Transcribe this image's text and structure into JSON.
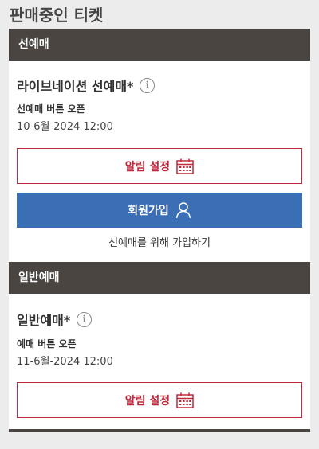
{
  "page": {
    "title": "판매중인 티켓"
  },
  "presale": {
    "header": "선예매",
    "ticket_name": "라이브네이션 선예매*",
    "open_label": "선예매 버튼 오픈",
    "open_date": "10-6월-2024 12:00",
    "alarm_label": "알림 설정",
    "join_label": "회원가입",
    "join_note": "선예매를 위해 가입하기"
  },
  "general": {
    "header": "일반예매",
    "ticket_name": "일반예매*",
    "open_label": "예매 버튼 오픈",
    "open_date": "11-6월-2024 12:00",
    "alarm_label": "알림 설정"
  },
  "colors": {
    "header_bg": "#4a4541",
    "accent_red": "#c0283c",
    "join_blue": "#3a6eb5"
  },
  "icons": {
    "info": "info-icon",
    "calendar": "calendar-icon",
    "user": "user-icon"
  }
}
